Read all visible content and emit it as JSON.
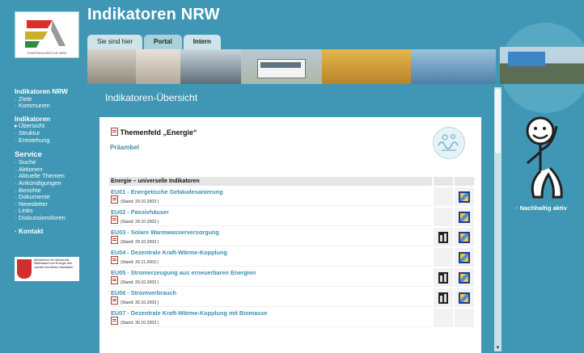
{
  "header": {
    "site_title": "Indikatoren NRW",
    "tabs": [
      {
        "label": "Sie sind hier"
      },
      {
        "label": "Portal"
      },
      {
        "label": "Intern"
      }
    ]
  },
  "sidebar": {
    "sections": [
      {
        "head": "Indikatoren NRW",
        "items": [
          "Ziele",
          "Kommunen"
        ]
      },
      {
        "head": "Indikatoren",
        "items": [
          "Übersicht",
          "Struktur",
          "Entstehung"
        ]
      },
      {
        "head": "Service",
        "items": [
          "Suche",
          "Aktionen",
          "Aktuelle Themen",
          "Ankündigungen",
          "Berichte",
          "Dokumente",
          "Newsletter",
          "Links",
          "Diskussionsforen"
        ]
      },
      {
        "head": "Kontakt",
        "items": []
      }
    ],
    "logo_text": "ENERGIEAGENTUR.NRW",
    "ministry_text": "Ministerium für Wirtschaft, Mittelstand und Energie des Landes Nordrhein-Westfalen"
  },
  "main": {
    "heading": "Indikatoren-Übersicht",
    "theme_title": "Themenfeld „Energie“",
    "praembel": "Präambel",
    "table_header": "Energie – universelle Indikatoren",
    "rows": [
      {
        "title": "EU01 - Energetische Gebäudesanierung",
        "stand": "(Stand: 29.10.2003 )",
        "chart": false,
        "map": true
      },
      {
        "title": "EU02 - Passivhäuser",
        "stand": "(Stand: 29.10.2003 )",
        "chart": false,
        "map": true
      },
      {
        "title": "EU03 - Solare Warmwasserversorgung",
        "stand": "(Stand: 29.10.2003 )",
        "chart": true,
        "map": true
      },
      {
        "title": "EU04 - Dezentrale Kraft-Wärme-Kopplung",
        "stand": "(Stand: 20.11.2003 )",
        "chart": false,
        "map": true
      },
      {
        "title": "EU05 - Stromerzeugung aus erneuerbaren Energien",
        "stand": "(Stand: 29.10.2003 )",
        "chart": true,
        "map": true
      },
      {
        "title": "EU06 - Stromverbrauch",
        "stand": "(Stand: 30.10.2003 )",
        "chart": true,
        "map": true
      },
      {
        "title": "EU07 - Dezentrale Kraft-Wärme-Kopplung mit Biomasse",
        "stand": "(Stand: 30.10.2003 )",
        "chart": false,
        "map": false
      }
    ]
  },
  "right": {
    "label": "Nachhaltig aktiv"
  },
  "colors": {
    "background": "#3f97b5",
    "link": "#3a8fb0",
    "panel": "#ffffff"
  }
}
